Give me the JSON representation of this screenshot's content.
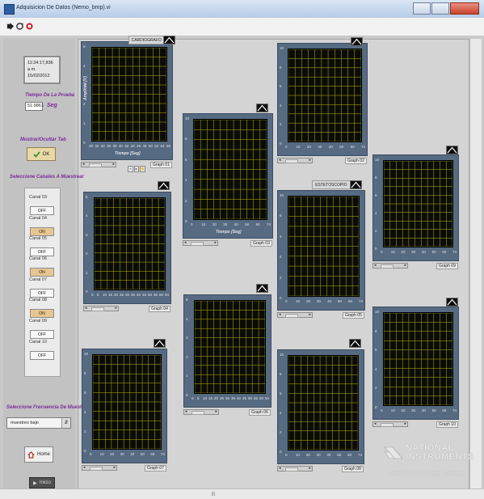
{
  "window": {
    "title": "Adquisicion De Datos (Nemo_bmp).vi"
  },
  "left_panel": {
    "clock_time": "11:24:17,836 a.m.",
    "clock_date": "15/02/2012",
    "test_time_label": "Tiempo De La Prueba",
    "test_time_value": "51.9861",
    "test_time_unit": "Seg",
    "show_hide_label": "Mostrar/Ocultar Tab",
    "ok_label": "OK",
    "channels_label": "Seleccione Canales A Muestrear",
    "channels": [
      {
        "name": "Canal 03",
        "state": "OFF"
      },
      {
        "name": "Canal 04",
        "state": "ON"
      },
      {
        "name": "Canal 05",
        "state": "OFF"
      },
      {
        "name": "Canal 06",
        "state": "ON"
      },
      {
        "name": "Canal 07",
        "state": "OFF"
      },
      {
        "name": "Canal 08",
        "state": "ON"
      },
      {
        "name": "Canal 09",
        "state": "OFF"
      },
      {
        "name": "Canal 10",
        "state": "OFF"
      }
    ],
    "frequency_label": "Seleccione Frecuencia De Muestreo",
    "frequency_value": "muestreo bajo",
    "home_label": "Home",
    "bottom_button_label": "Inicio"
  },
  "graphs": [
    {
      "id": "g01",
      "label": "Graph 01",
      "tag": "CARDIOGRAFO",
      "ylabel": "Amplitud [V]",
      "xlabel": "Tiempo [Seg]",
      "yticks": [
        "5",
        "4",
        "3",
        "2",
        "1",
        "0"
      ],
      "xticks": [
        "30",
        "32",
        "34",
        "36",
        "38",
        "40",
        "42",
        "44",
        "46",
        "48",
        "50",
        "52",
        "54",
        "56"
      ]
    },
    {
      "id": "g02",
      "label": "Graph 02",
      "tag": "",
      "ylabel": "",
      "xlabel": "",
      "yticks": [
        "10",
        "8",
        "6",
        "4",
        "2",
        "0"
      ],
      "xticks": [
        "0",
        "10",
        "20",
        "30",
        "40",
        "50",
        "60",
        "74"
      ]
    },
    {
      "id": "g03",
      "label": "Graph 03",
      "tag": "",
      "ylabel": "",
      "xlabel": "Tiempo [Seg]",
      "yticks": [
        "10",
        "8",
        "6",
        "4",
        "2",
        "0"
      ],
      "xticks": [
        "0",
        "10",
        "20",
        "30",
        "40",
        "50",
        "60",
        "74"
      ]
    },
    {
      "id": "g04",
      "label": "Graph 04",
      "tag": "",
      "ylabel": "",
      "xlabel": "",
      "yticks": [
        "5",
        "4",
        "3",
        "2",
        "1",
        "0"
      ],
      "xticks": [
        "0",
        "5",
        "10",
        "15",
        "20",
        "25",
        "30",
        "35",
        "40",
        "45",
        "50",
        "55",
        "60",
        "64"
      ]
    },
    {
      "id": "g05",
      "label": "Graph 05",
      "tag": "ESTETOSCOPIO",
      "ylabel": "",
      "xlabel": "",
      "yticks": [
        "10",
        "8",
        "6",
        "4",
        "2",
        "0"
      ],
      "xticks": [
        "0",
        "10",
        "20",
        "30",
        "40",
        "50",
        "60",
        "74"
      ]
    },
    {
      "id": "g06",
      "label": "Graph 06",
      "tag": "",
      "ylabel": "",
      "xlabel": "",
      "yticks": [
        "5",
        "4",
        "3",
        "2",
        "1",
        "0"
      ],
      "xticks": [
        "0",
        "5",
        "10",
        "15",
        "20",
        "25",
        "30",
        "35",
        "40",
        "45",
        "50",
        "55",
        "60",
        "64"
      ]
    },
    {
      "id": "g07",
      "label": "Graph 07",
      "tag": "",
      "ylabel": "",
      "xlabel": "",
      "yticks": [
        "10",
        "8",
        "6",
        "4",
        "2",
        "0"
      ],
      "xticks": [
        "0",
        "10",
        "20",
        "30",
        "40",
        "50",
        "60",
        "74"
      ]
    },
    {
      "id": "g08",
      "label": "Graph 08",
      "tag": "",
      "ylabel": "",
      "xlabel": "",
      "yticks": [
        "10",
        "8",
        "6",
        "4",
        "2",
        "0"
      ],
      "xticks": [
        "0",
        "10",
        "20",
        "30",
        "40",
        "50",
        "60",
        "74"
      ]
    },
    {
      "id": "g09",
      "label": "Graph 09",
      "tag": "",
      "ylabel": "",
      "xlabel": "",
      "yticks": [
        "10",
        "8",
        "6",
        "4",
        "2",
        "0"
      ],
      "xticks": [
        "0",
        "10",
        "20",
        "30",
        "40",
        "50",
        "60",
        "74"
      ]
    },
    {
      "id": "g10",
      "label": "Graph 10",
      "tag": "",
      "ylabel": "",
      "xlabel": "",
      "yticks": [
        "10",
        "8",
        "6",
        "4",
        "2",
        "0"
      ],
      "xticks": [
        "0",
        "10",
        "20",
        "30",
        "40",
        "50",
        "60",
        "74"
      ]
    }
  ],
  "watermark": {
    "line1": "NATIONAL",
    "line2": "INSTRUMENTS",
    "line3": "LabVIEW Evaluation Software"
  },
  "colors": {
    "plot_bg": "#0b0c08",
    "grid": "#b8b400",
    "frame": "#566a82",
    "window_bg": "#c9c9c9"
  }
}
